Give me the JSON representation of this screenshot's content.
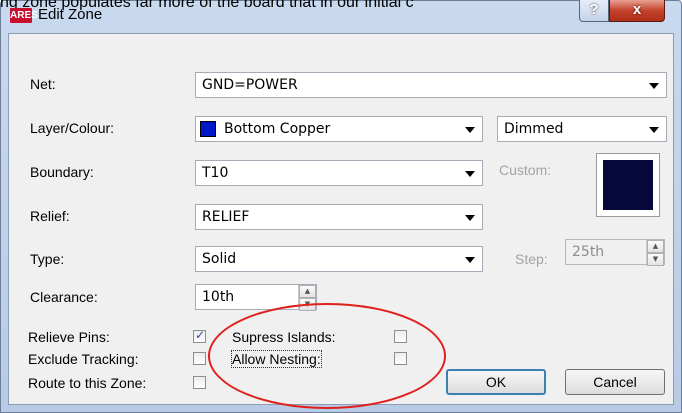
{
  "caption": "ng zone populates far more of the board that in our initial c",
  "window": {
    "title": "Edit Zone",
    "app_icon_text": "ARES",
    "help_label": "?",
    "close_label": "x"
  },
  "form": {
    "net_label": "Net:",
    "net_value": "GND=POWER",
    "layer_label": "Layer/Colour:",
    "layer_value": "Bottom Copper",
    "layer_color": "#0018c8",
    "display_value": "Dimmed",
    "boundary_label": "Boundary:",
    "boundary_value": "T10",
    "custom_label": "Custom:",
    "custom_color": "#07093d",
    "relief_label": "Relief:",
    "relief_value": "RELIEF",
    "type_label": "Type:",
    "type_value": "Solid",
    "step_label": "Step:",
    "step_value": "25th",
    "clearance_label": "Clearance:",
    "clearance_value": "10th"
  },
  "options": {
    "relieve_pins_label": "Relieve Pins:",
    "relieve_pins_checked": true,
    "exclude_tracking_label": "Exclude Tracking:",
    "exclude_tracking_checked": false,
    "route_to_zone_label": "Route to this Zone:",
    "route_to_zone_checked": false,
    "supress_islands_label": "Supress Islands:",
    "supress_islands_checked": false,
    "allow_nesting_label": "Allow Nesting:",
    "allow_nesting_checked": false
  },
  "buttons": {
    "ok_label": "OK",
    "cancel_label": "Cancel"
  },
  "annotation_color": "#e0201c"
}
